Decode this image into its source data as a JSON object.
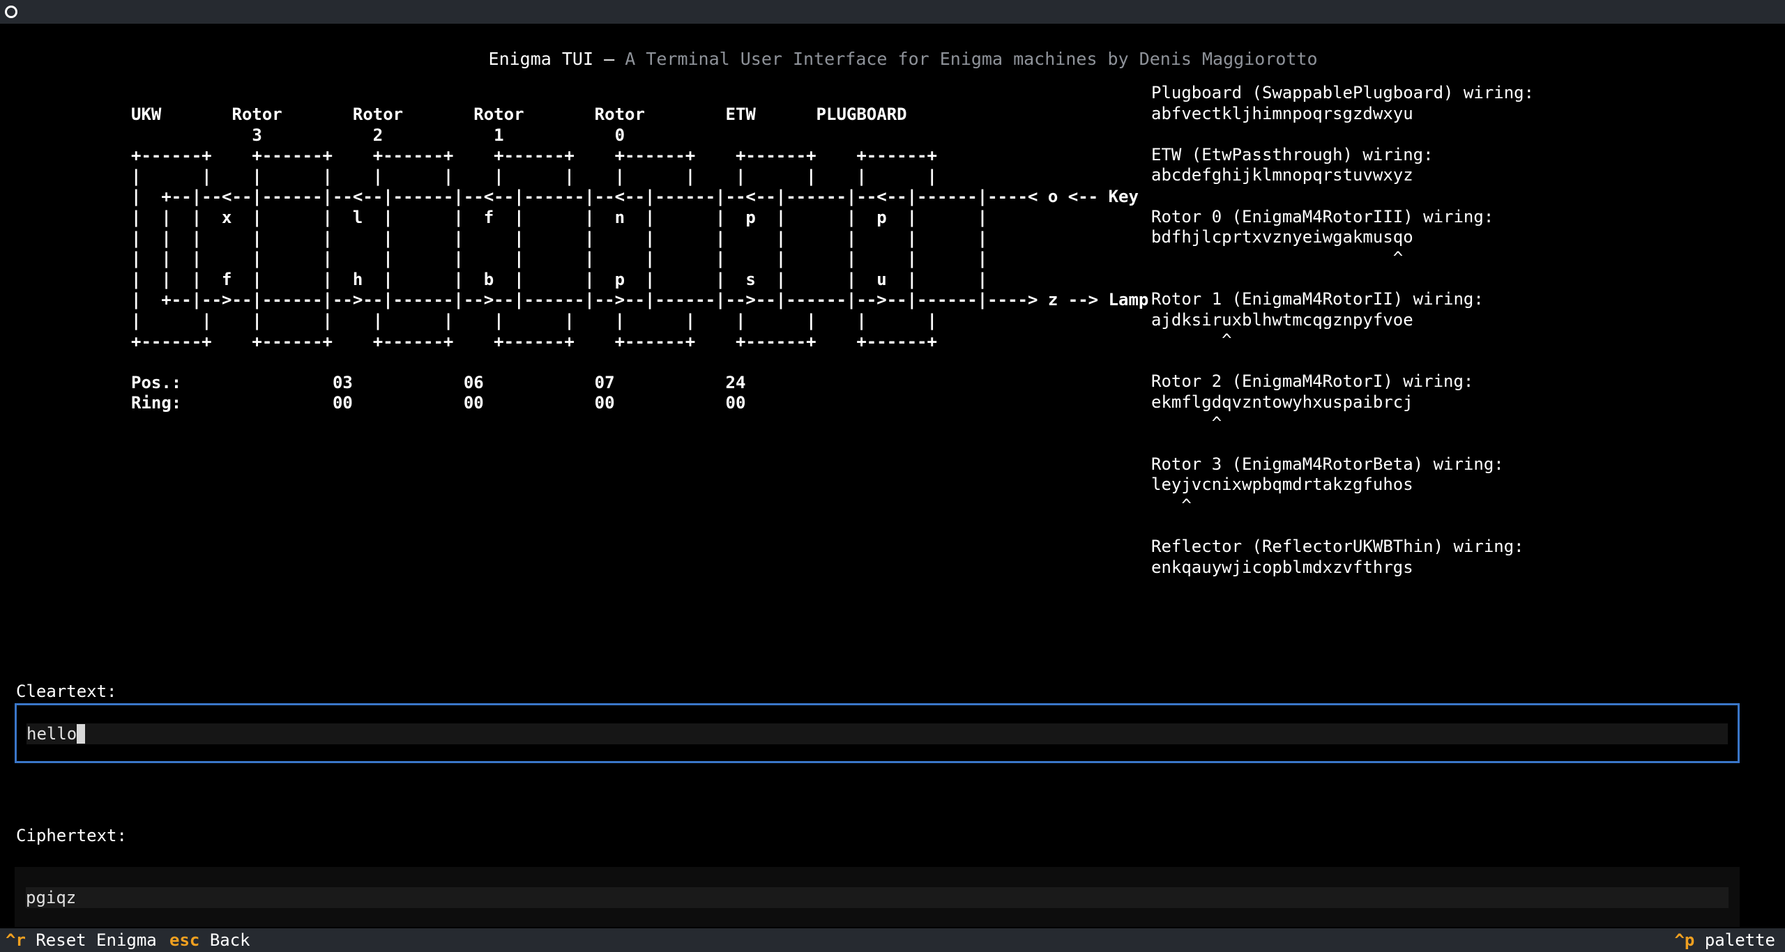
{
  "window": {
    "title": "Enigma TUI",
    "separator": " — ",
    "subtitle": "A Terminal User Interface for Enigma machines by Denis Maggiorotto"
  },
  "diagram": {
    "lines": [
      "UKW       Rotor       Rotor       Rotor       Rotor        ETW      PLUGBOARD",
      "            3           2           1           0",
      "+------+    +------+    +------+    +------+    +------+    +------+    +------+",
      "|      |    |      |    |      |    |      |    |      |    |      |    |      |",
      "|  +--|--<--|------|--<--|------|--<--|------|--<--|------|--<--|------|--<--|------|----< o <-- Key",
      "|  |  |  x  |      |  l  |      |  f  |      |  n  |      |  p  |      |  p  |      |",
      "|  |  |     |      |     |      |     |      |     |      |     |      |     |      |",
      "|  |  |     |      |     |      |     |      |     |      |     |      |     |      |",
      "|  |  |  f  |      |  h  |      |  b  |      |  p  |      |  s  |      |  u  |      |",
      "|  +--|-->--|------|-->--|------|-->--|------|-->--|------|-->--|------|-->--|------|----> z --> Lamp",
      "|      |    |      |    |      |    |      |    |      |    |      |    |      |",
      "+------+    +------+    +------+    +------+    +------+    +------+    +------+",
      "",
      "Pos.:               03           06           07           24",
      "Ring:               00           00           00           00"
    ]
  },
  "wirings": [
    {
      "title": "Plugboard (SwappablePlugboard) wiring:",
      "value": "abfvectkljhimnpoqrsgzdwxyu",
      "marker": ""
    },
    {
      "title": "ETW (EtwPassthrough) wiring:",
      "value": "abcdefghijklmnopqrstuvwxyz",
      "marker": ""
    },
    {
      "title": "Rotor 0 (EnigmaM4RotorIII) wiring:",
      "value": "bdfhjlcprtxvznyeiwgakmusqo",
      "marker": "                        ^"
    },
    {
      "title": "Rotor 1 (EnigmaM4RotorII) wiring:",
      "value": "ajdksiruxblhwtmcqgznpyfvoe",
      "marker": "       ^"
    },
    {
      "title": "Rotor 2 (EnigmaM4RotorI) wiring:",
      "value": "ekmflgdqvzntowyhxuspaibrcj",
      "marker": "      ^"
    },
    {
      "title": "Rotor 3 (EnigmaM4RotorBeta) wiring:",
      "value": "leyjvcnixwpbqmdrtakzgfuhos",
      "marker": "   ^"
    },
    {
      "title": "Reflector (ReflectorUKWBThin) wiring:",
      "value": "enkqauywjicopblmdxzvfthrgs",
      "marker": ""
    }
  ],
  "cleartext": {
    "label": "Cleartext:",
    "value": "hello"
  },
  "ciphertext": {
    "label": "Ciphertext:",
    "value": "pgiqz"
  },
  "footer": {
    "reset": {
      "key": "^r",
      "label": "Reset Enigma"
    },
    "back": {
      "key": "esc",
      "label": "Back"
    },
    "palette": {
      "key": "^p",
      "label": "palette"
    }
  },
  "colors": {
    "accent": "#3a76c8",
    "key_highlight": "#f0a020",
    "bar_bg": "#262a30"
  }
}
